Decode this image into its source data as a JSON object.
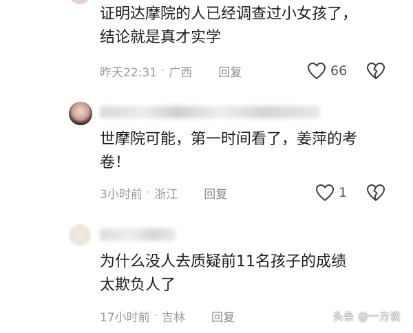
{
  "comments": [
    {
      "text": "证明达摩院的人已经调查过小女孩了，\n结论就是真才实学",
      "time": "昨天22:31",
      "location": "广西",
      "reply_label": "回复",
      "like_count": "66"
    },
    {
      "text": "世摩院可能，第一时间看了，姜萍的考\n卷！",
      "time": "3小时前",
      "location": "浙江",
      "reply_label": "回复",
      "like_count": "1"
    },
    {
      "text": "为什么没人去质疑前11名孩子的成绩\n太欺负人了",
      "time": "17小时前",
      "location": "吉林",
      "reply_label": "回复",
      "like_count": ""
    }
  ],
  "separator": "·",
  "icons": {
    "like": "heart-outline-icon",
    "dislike": "broken-heart-icon"
  },
  "watermark": "头条 @一方说"
}
